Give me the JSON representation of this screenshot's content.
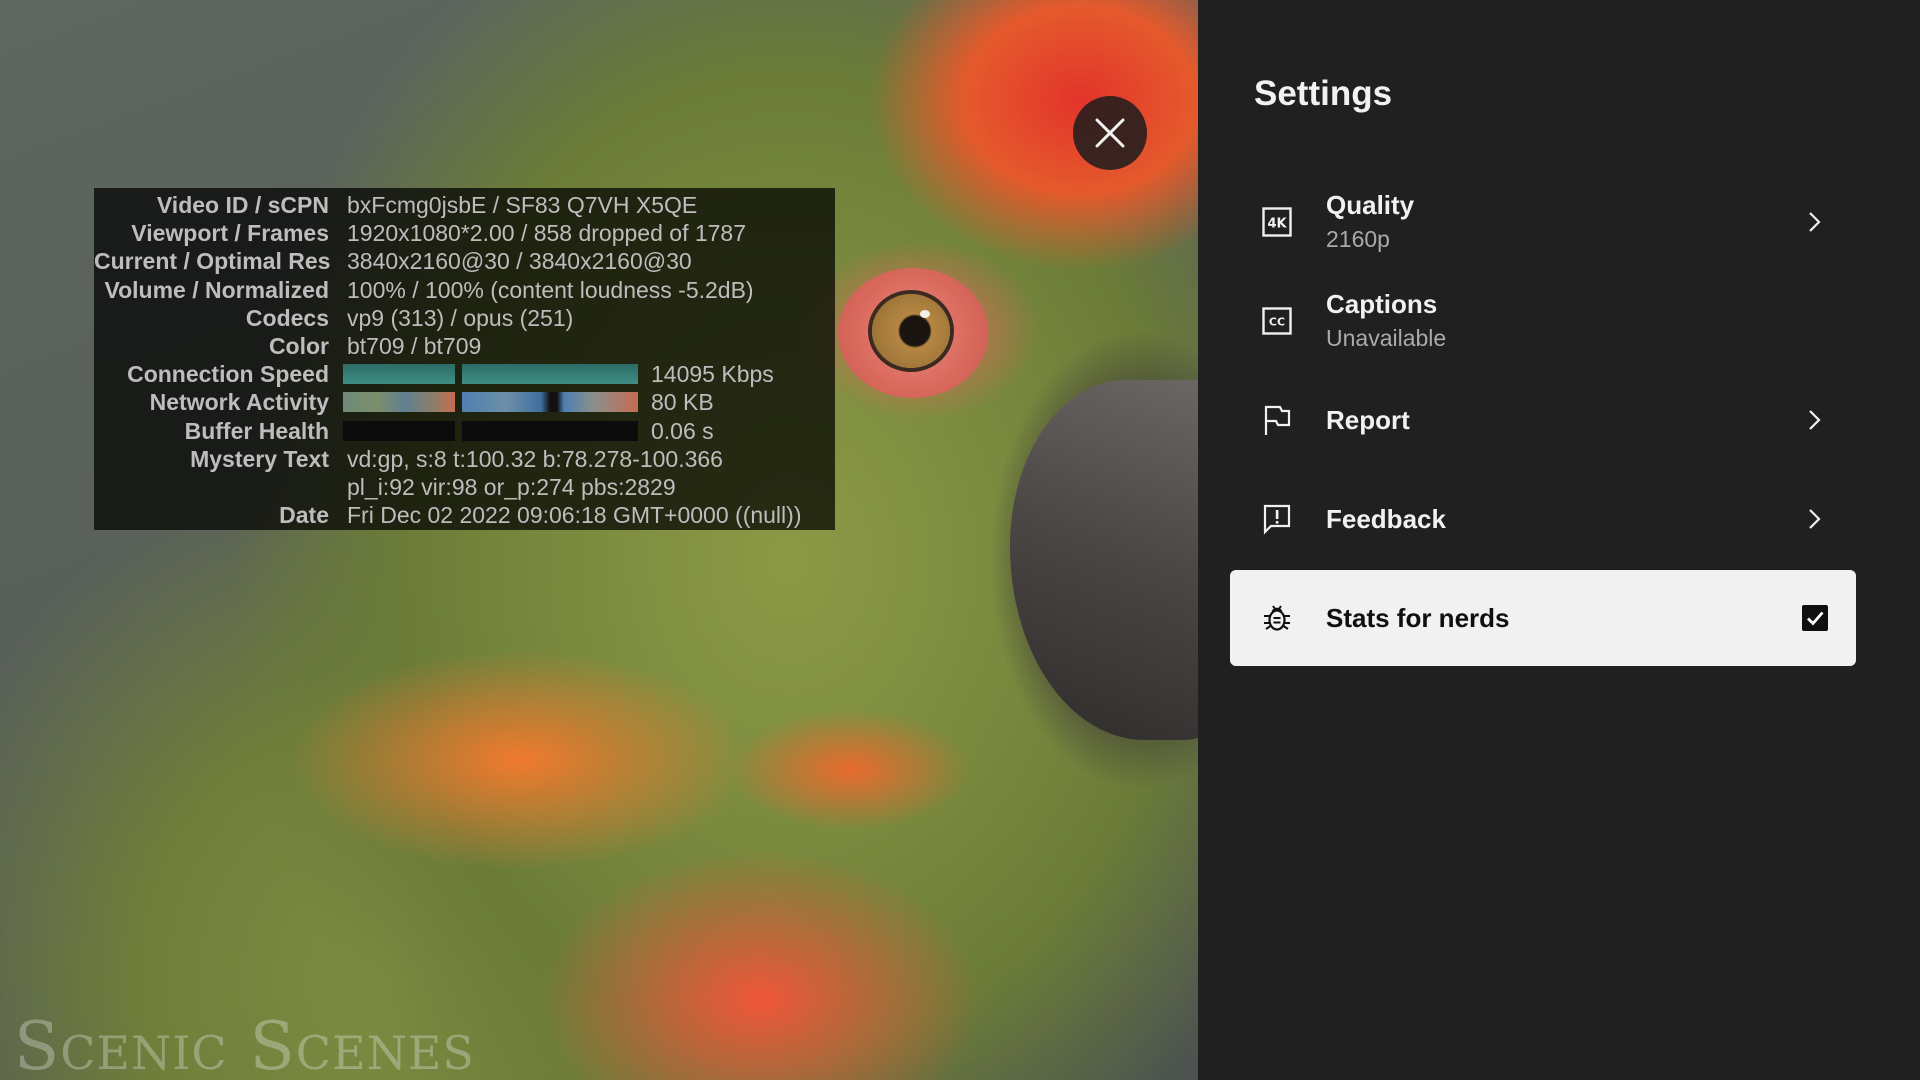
{
  "video": {
    "watermark": "Scenic Scenes",
    "close_icon": "close-icon"
  },
  "stats": {
    "rows": [
      {
        "label": "Video ID / sCPN",
        "value": "bxFcmg0jsbE / SF83 Q7VH X5QE"
      },
      {
        "label": "Viewport / Frames",
        "value": "1920x1080*2.00 / 858 dropped of 1787"
      },
      {
        "label": "Current / Optimal Res",
        "value": "3840x2160@30 / 3840x2160@30"
      },
      {
        "label": "Volume / Normalized",
        "value": "100% / 100% (content loudness -5.2dB)"
      },
      {
        "label": "Codecs",
        "value": "vp9 (313) / opus (251)"
      },
      {
        "label": "Color",
        "value": "bt709 / bt709"
      }
    ],
    "connection_speed": {
      "label": "Connection Speed",
      "value": "14095 Kbps"
    },
    "network_activity": {
      "label": "Network Activity",
      "value": "80 KB"
    },
    "buffer_health": {
      "label": "Buffer Health",
      "value": "0.06 s"
    },
    "mystery_text": {
      "label": "Mystery Text",
      "line1": "vd:gp, s:8 t:100.32 b:78.278-100.366",
      "line2": "pl_i:92 vir:98 or_p:274 pbs:2829"
    },
    "date": {
      "label": "Date",
      "value": "Fri Dec 02 2022 09:06:18 GMT+0000 ((null))"
    },
    "colors": {
      "speed": "#3f8f86",
      "network_a": "#6c8a7a",
      "network_b": "#4f7fb3",
      "network_c": "#c76b52",
      "buffer": "#0b0b0b"
    }
  },
  "settings": {
    "title": "Settings",
    "items": [
      {
        "label": "Quality",
        "sub": "2160p",
        "icon": "4k-icon"
      },
      {
        "label": "Captions",
        "sub": "Unavailable",
        "icon": "closed-captions-icon"
      },
      {
        "label": "Report",
        "icon": "flag-icon"
      },
      {
        "label": "Feedback",
        "icon": "feedback-icon"
      },
      {
        "label": "Stats for nerds",
        "icon": "bug-icon",
        "checked": true
      }
    ],
    "colors": {
      "panel_bg": "#202020",
      "selected_bg": "#f1f1f1",
      "text": "#f1f1f1",
      "subtext": "#aaaaaa"
    }
  }
}
